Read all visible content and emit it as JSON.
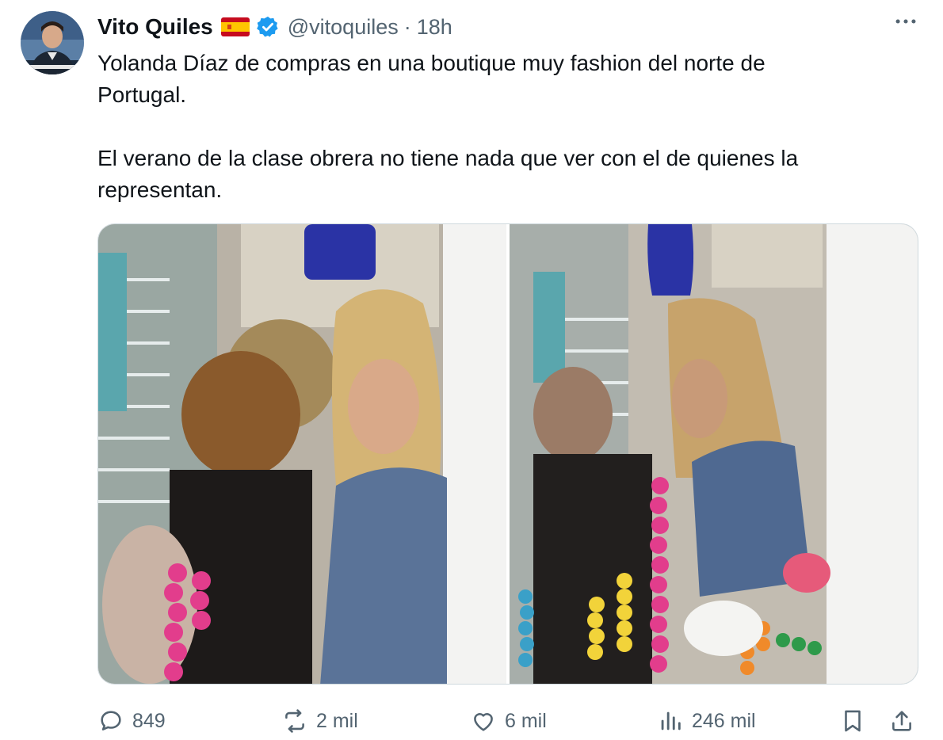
{
  "tweet": {
    "author_name": "Vito Quiles",
    "author_handle": "@vitoquiles",
    "separator": "·",
    "time": "18h",
    "more_icon": "more-horizontal-icon",
    "flag_icon": "spain-flag-icon",
    "verified_icon": "verified-badge-icon",
    "text_lines": [
      "Yolanda Díaz de compras en una boutique muy fashion del norte de Portugal.",
      "El verano de la clase obrera no tiene nada que ver con el de quienes la representan."
    ],
    "media_count": 2
  },
  "actions": {
    "replies": "849",
    "reposts": "2 mil",
    "likes": "6 mil",
    "views": "246 mil",
    "reply_icon": "reply-icon",
    "repost_icon": "repost-icon",
    "like_icon": "heart-icon",
    "views_icon": "analytics-icon",
    "bookmark_icon": "bookmark-icon",
    "share_icon": "share-icon"
  },
  "colors": {
    "text": "#0f1419",
    "secondary": "#536471",
    "verified": "#1d9bf0",
    "border": "#cfd9de"
  }
}
